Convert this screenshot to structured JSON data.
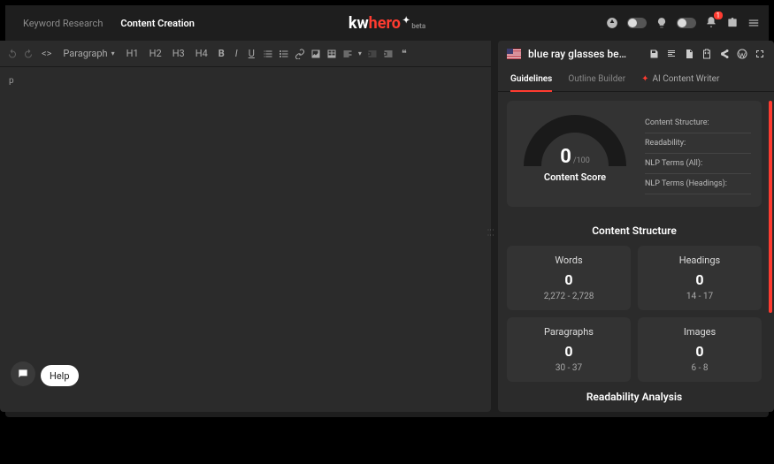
{
  "nav": {
    "keyword_research": "Keyword Research",
    "content_creation": "Content Creation"
  },
  "logo": {
    "part1": "kw",
    "part2": "hero",
    "beta": "beta"
  },
  "notifications": {
    "count": "1"
  },
  "toolbar": {
    "paragraph": "Paragraph",
    "h1": "H1",
    "h2": "H2",
    "h3": "H3",
    "h4": "H4",
    "bold": "B",
    "italic": "I",
    "underline": "U",
    "quote": "❝"
  },
  "editor": {
    "placeholder": "p"
  },
  "doc": {
    "title": "blue ray glasses be…"
  },
  "tabs": {
    "guidelines": "Guidelines",
    "outline_builder": "Outline Builder",
    "ai_writer": "AI Content Writer"
  },
  "score": {
    "value": "0",
    "max": "/100",
    "label": "Content Score"
  },
  "metrics": {
    "content_structure": "Content Structure:",
    "readability": "Readability:",
    "nlp_all": "NLP Terms (All):",
    "nlp_headings": "NLP Terms (Headings):"
  },
  "sections": {
    "content_structure": "Content Structure",
    "readability_analysis": "Readability Analysis"
  },
  "stats": {
    "words": {
      "title": "Words",
      "value": "0",
      "range": "2,272  - 2,728"
    },
    "headings": {
      "title": "Headings",
      "value": "0",
      "range": "14  - 17"
    },
    "paragraphs": {
      "title": "Paragraphs",
      "value": "0",
      "range": "30  - 37"
    },
    "images": {
      "title": "Images",
      "value": "0",
      "range": "6  - 8"
    }
  },
  "help": {
    "label": "Help"
  }
}
